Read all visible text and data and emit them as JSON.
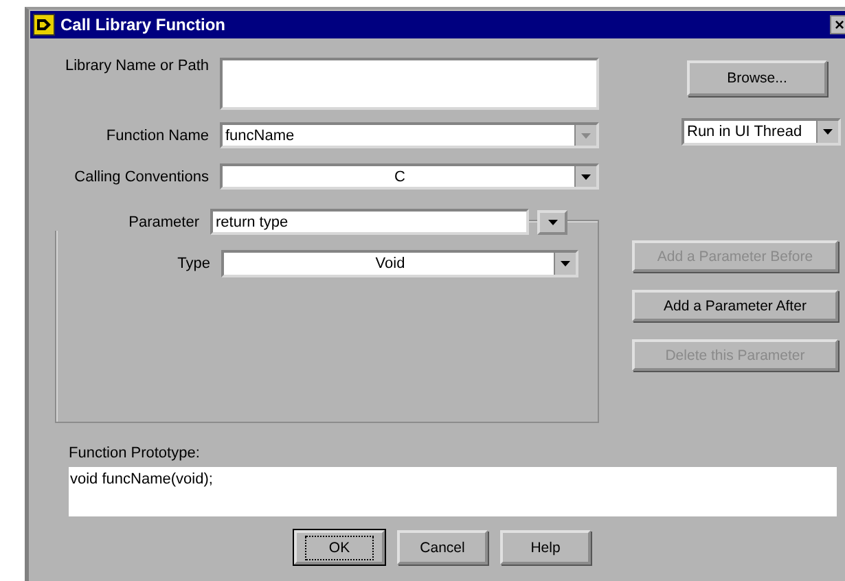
{
  "window": {
    "title": "Call Library Function",
    "close": "×"
  },
  "library": {
    "label": "Library Name or Path"
  },
  "function_name": {
    "label": "Function Name",
    "value": "funcName"
  },
  "calling_conventions": {
    "label": "Calling Conventions",
    "value": "C"
  },
  "parameter": {
    "label": "Parameter",
    "value": "return type"
  },
  "type": {
    "label": "Type",
    "value": "Void"
  },
  "browse_button": {
    "label": "Browse..."
  },
  "thread_select": {
    "value": "Run in UI Thread"
  },
  "parameter_buttons": [
    {
      "label": "Add a Parameter Before",
      "disabled": true
    },
    {
      "label": "Add a Parameter After",
      "disabled": false
    },
    {
      "label": "Delete this Parameter",
      "disabled": true
    }
  ],
  "prototype": {
    "label": "Function Prototype:",
    "value": "void funcName(void);"
  },
  "dialog_buttons": [
    {
      "label": "OK",
      "default": true
    },
    {
      "label": "Cancel",
      "default": false
    },
    {
      "label": "Help",
      "default": false
    }
  ]
}
